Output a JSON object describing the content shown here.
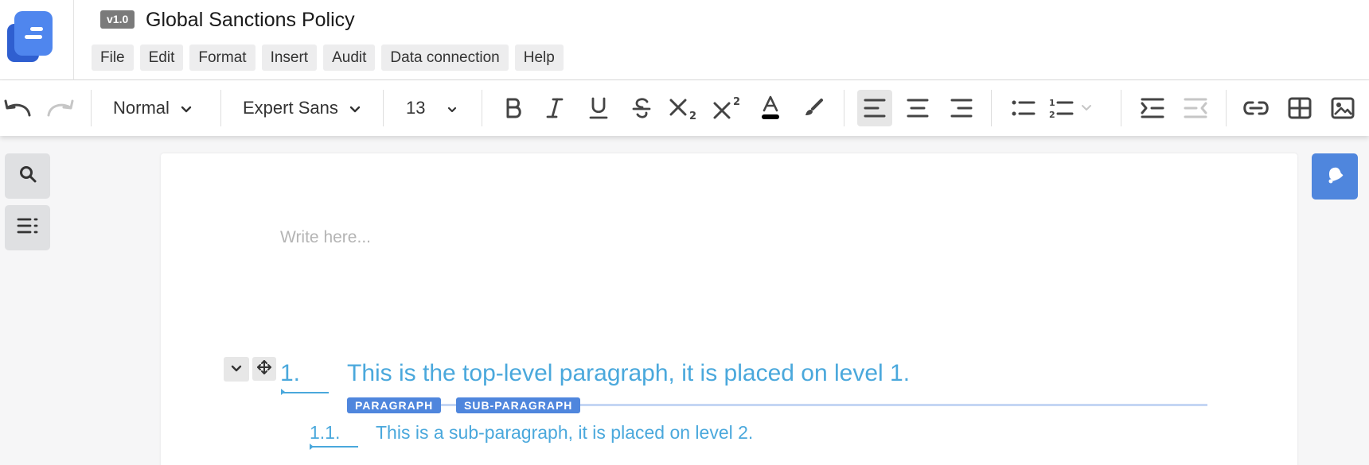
{
  "header": {
    "version": "v1.0",
    "title": "Global Sanctions Policy"
  },
  "menu": [
    "File",
    "Edit",
    "Format",
    "Insert",
    "Audit",
    "Data connection",
    "Help"
  ],
  "toolbar": {
    "paragraph_style": "Normal",
    "font_family": "Expert Sans",
    "font_size": "13",
    "subscript_digit": "2",
    "superscript_digit": "2",
    "text_color_swatch": "#000000",
    "active_alignment": "align-left"
  },
  "sidebar": {
    "items": [
      "search-icon",
      "outline-list-icon"
    ]
  },
  "editor": {
    "placeholder": "Write here...",
    "paragraph": {
      "number": "1.",
      "text": "This is the top-level paragraph, it is placed on level 1."
    },
    "tags": [
      "PARAGRAPH",
      "SUB-PARAGRAPH"
    ],
    "subparagraph": {
      "number": "1.1.",
      "text": "This is a sub-paragraph, it is placed on level 2."
    }
  },
  "colors": {
    "accent": "#4f86dd",
    "paragraph_text": "#4aa8dc"
  }
}
